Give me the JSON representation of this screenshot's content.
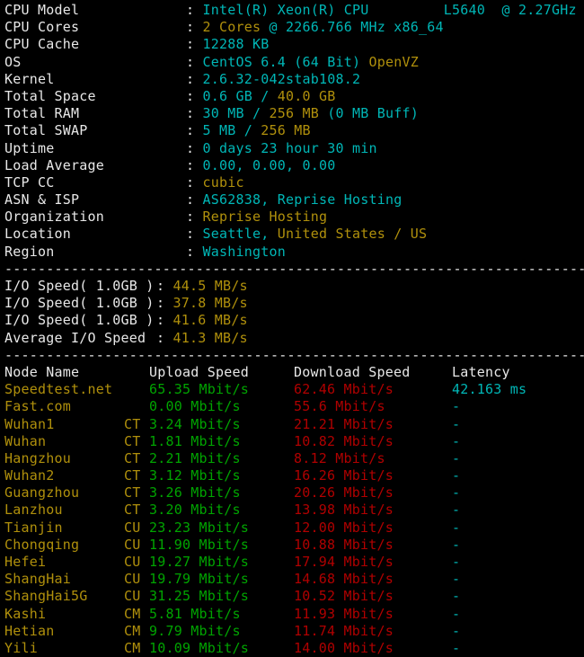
{
  "terminal": {
    "background": "#000000",
    "colors": {
      "white": "#e8e8e8",
      "cyan": "#00b6b6",
      "yellow": "#b0900c",
      "green": "#00a400",
      "red": "#b00000"
    },
    "separator": "----------------------------------------------------------------------"
  },
  "system_info": [
    {
      "label": "CPU Model",
      "value_cyan": "Intel(R) Xeon(R) CPU",
      "value_yellow": "",
      "value_cyan2": "         L5640  @ 2.27GHz"
    },
    {
      "label": "CPU Cores",
      "value_cyan": "",
      "value_yellow": "2 Cores",
      "value_cyan2": " @ 2266.766 MHz x86_64"
    },
    {
      "label": "CPU Cache",
      "value_cyan": "12288 KB",
      "value_yellow": "",
      "value_cyan2": ""
    },
    {
      "label": "OS",
      "value_cyan": "CentOS 6.4 (64 Bit) ",
      "value_yellow": "OpenVZ",
      "value_cyan2": ""
    },
    {
      "label": "Kernel",
      "value_cyan": "2.6.32-042stab108.2",
      "value_yellow": "",
      "value_cyan2": ""
    },
    {
      "label": "Total Space",
      "value_cyan": "0.6 GB / ",
      "value_yellow": "40.0 GB",
      "value_cyan2": ""
    },
    {
      "label": "Total RAM",
      "value_cyan": "30 MB / ",
      "value_yellow": "256 MB",
      "value_cyan2": " (0 MB Buff)"
    },
    {
      "label": "Total SWAP",
      "value_cyan": "5 MB / ",
      "value_yellow": "256 MB",
      "value_cyan2": ""
    },
    {
      "label": "Uptime",
      "value_cyan": "0 days 23 hour 30 min",
      "value_yellow": "",
      "value_cyan2": ""
    },
    {
      "label": "Load Average",
      "value_cyan": "0.00, 0.00, 0.00",
      "value_yellow": "",
      "value_cyan2": ""
    },
    {
      "label": "TCP CC",
      "value_cyan": "",
      "value_yellow": "cubic",
      "value_cyan2": ""
    },
    {
      "label": "ASN & ISP",
      "value_cyan": "AS62838, Reprise Hosting",
      "value_yellow": "",
      "value_cyan2": ""
    },
    {
      "label": "Organization",
      "value_cyan": "",
      "value_yellow": "Reprise Hosting",
      "value_cyan2": ""
    },
    {
      "label": "Location",
      "value_cyan": "Seattle, ",
      "value_yellow": "United States / US",
      "value_cyan2": ""
    },
    {
      "label": "Region",
      "value_cyan": "Washington",
      "value_yellow": "",
      "value_cyan2": ""
    }
  ],
  "io_section": [
    {
      "label": "I/O Speed( 1.0GB )",
      "value": "44.5 MB/s"
    },
    {
      "label": "I/O Speed( 1.0GB )",
      "value": "37.8 MB/s"
    },
    {
      "label": "I/O Speed( 1.0GB )",
      "value": "41.6 MB/s"
    },
    {
      "label": "Average I/O Speed",
      "value": "41.3 MB/s"
    }
  ],
  "speedtest": {
    "headers": {
      "node": "Node Name",
      "upload": "Upload Speed",
      "download": "Download Speed",
      "latency": "Latency"
    },
    "rows": [
      {
        "node": "Speedtest.net",
        "isp": "",
        "upload": "65.35 Mbit/s",
        "download": "62.46 Mbit/s",
        "latency": "42.163 ms"
      },
      {
        "node": "Fast.com",
        "isp": "",
        "upload": "0.00 Mbit/s",
        "download": "55.6 Mbit/s",
        "latency": "-"
      },
      {
        "node": "Wuhan1",
        "isp": "CT",
        "upload": "3.24 Mbit/s",
        "download": "21.21 Mbit/s",
        "latency": "-"
      },
      {
        "node": "Wuhan",
        "isp": "CT",
        "upload": "1.81 Mbit/s",
        "download": "10.82 Mbit/s",
        "latency": "-"
      },
      {
        "node": "Hangzhou",
        "isp": "CT",
        "upload": "2.21 Mbit/s",
        "download": "8.12 Mbit/s",
        "latency": "-"
      },
      {
        "node": "Wuhan2",
        "isp": "CT",
        "upload": "3.12 Mbit/s",
        "download": "16.26 Mbit/s",
        "latency": "-"
      },
      {
        "node": "Guangzhou",
        "isp": "CT",
        "upload": "3.26 Mbit/s",
        "download": "20.26 Mbit/s",
        "latency": "-"
      },
      {
        "node": "Lanzhou",
        "isp": "CT",
        "upload": "3.20 Mbit/s",
        "download": "13.98 Mbit/s",
        "latency": "-"
      },
      {
        "node": "Tianjin",
        "isp": "CU",
        "upload": "23.23 Mbit/s",
        "download": "12.00 Mbit/s",
        "latency": "-"
      },
      {
        "node": "Chongqing",
        "isp": "CU",
        "upload": "11.90 Mbit/s",
        "download": "10.88 Mbit/s",
        "latency": "-"
      },
      {
        "node": "Hefei",
        "isp": "CU",
        "upload": "19.27 Mbit/s",
        "download": "17.94 Mbit/s",
        "latency": "-"
      },
      {
        "node": "ShangHai",
        "isp": "CU",
        "upload": "19.79 Mbit/s",
        "download": "14.68 Mbit/s",
        "latency": "-"
      },
      {
        "node": "ShangHai5G",
        "isp": "CU",
        "upload": "31.25 Mbit/s",
        "download": "10.52 Mbit/s",
        "latency": "-"
      },
      {
        "node": "Kashi",
        "isp": "CM",
        "upload": "5.81 Mbit/s",
        "download": "11.93 Mbit/s",
        "latency": "-"
      },
      {
        "node": "Hetian",
        "isp": "CM",
        "upload": "9.79 Mbit/s",
        "download": "11.74 Mbit/s",
        "latency": "-"
      },
      {
        "node": "Yili",
        "isp": "CM",
        "upload": "10.09 Mbit/s",
        "download": "14.00 Mbit/s",
        "latency": "-"
      }
    ]
  }
}
